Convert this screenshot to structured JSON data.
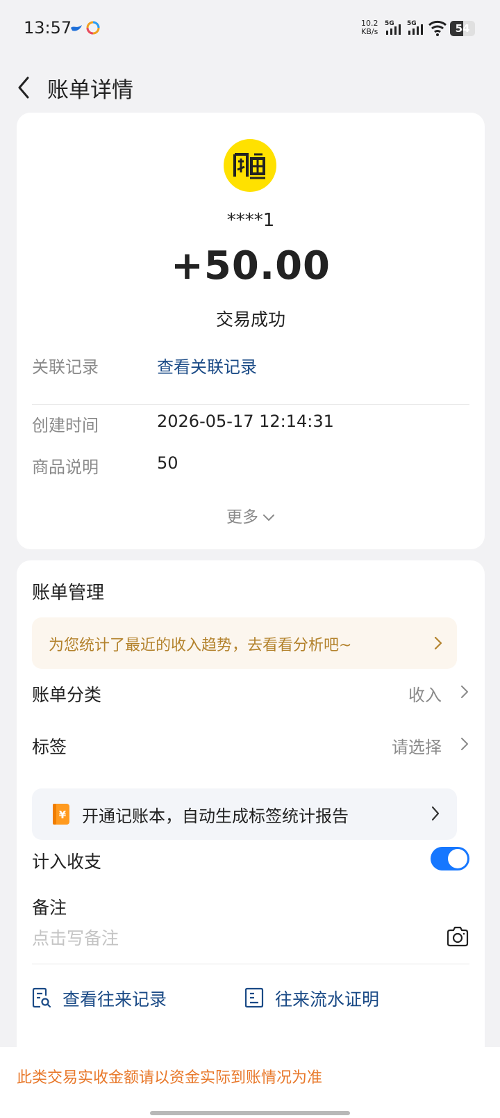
{
  "status_bar": {
    "time": "13:57",
    "net_speed_value": "10.2",
    "net_speed_unit": "KB/s",
    "signal1_label": "5G",
    "signal2_label": "5G",
    "battery": "54",
    "battery_level": 0.54
  },
  "header": {
    "title": "账单详情",
    "back_icon": "chevron-left-icon"
  },
  "summary": {
    "merchant_logo": "xianyu-logo",
    "merchant_name": "****1",
    "amount": "+50.00",
    "status": "交易成功",
    "related_label": "关联记录",
    "related_link": "查看关联记录",
    "created_label": "创建时间",
    "created_value": "2026-05-17 12:14:31",
    "product_label": "商品说明",
    "product_value": "50",
    "more_label": "更多"
  },
  "management": {
    "title": "账单管理",
    "trend_banner": "为您统计了最近的收入趋势，去看看分析吧~",
    "category_label": "账单分类",
    "category_value": "收入",
    "tag_label": "标签",
    "tag_value": "请选择",
    "ledger_banner": "开通记账本，自动生成标签统计报告",
    "include_label": "计入收支",
    "include_enabled": true,
    "remark_label": "备注",
    "remark_placeholder": "点击写备注",
    "records_link": "查看往来记录",
    "proof_link": "往来流水证明"
  },
  "notice": "此类交易实收金额请以资金实际到账情况为准",
  "colors": {
    "accent_blue": "#1677ff",
    "link_blue": "#1a4a86",
    "notice_orange": "#e8782a",
    "trend_gold": "#b3822c",
    "logo_yellow": "#ffe100"
  }
}
